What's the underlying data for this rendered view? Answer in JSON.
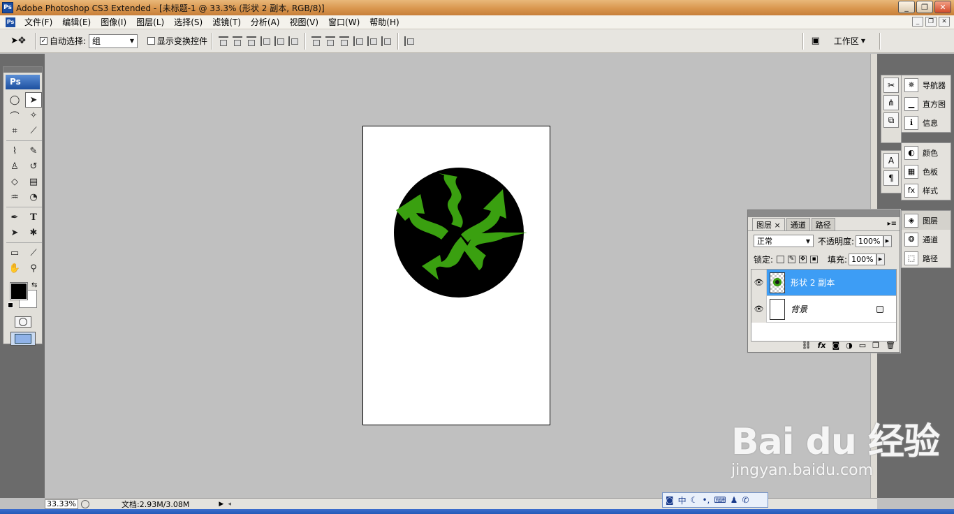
{
  "window": {
    "title": "Adobe Photoshop CS3 Extended - [未标题-1 @ 33.3% (形状 2 副本, RGB/8)]",
    "app_badge": "Ps",
    "buttons": [
      "_",
      "❐",
      "✕"
    ]
  },
  "menu": {
    "items": [
      "文件(F)",
      "编辑(E)",
      "图像(I)",
      "图层(L)",
      "选择(S)",
      "滤镜(T)",
      "分析(A)",
      "视图(V)",
      "窗口(W)",
      "帮助(H)"
    ],
    "doc_buttons": [
      "_",
      "❐",
      "✕"
    ]
  },
  "options": {
    "auto_select_label": "自动选择:",
    "auto_select_checked": "✓",
    "auto_select_value": "组",
    "show_transform_label": "显示变换控件",
    "workspace_label": "工作区"
  },
  "toolbox": {
    "logo": "Ps"
  },
  "dock": {
    "group1": [
      "导航器",
      "直方图",
      "信息"
    ],
    "group2": [
      "颜色",
      "色板",
      "样式"
    ],
    "group3": [
      "图层",
      "通道",
      "路径"
    ]
  },
  "layers_panel": {
    "tabs": [
      "图层 ×",
      "通道",
      "路径"
    ],
    "blend_mode": "正常",
    "opacity_label": "不透明度:",
    "opacity_value": "100%",
    "lock_label": "锁定:",
    "fill_label": "填充:",
    "fill_value": "100%",
    "layers": [
      {
        "name": "形状 2 副本",
        "selected": true
      },
      {
        "name": "背景",
        "selected": false
      }
    ]
  },
  "status": {
    "zoom": "33.33%",
    "doc_info": "文档:2.93M/3.08M"
  },
  "ime": {
    "items": [
      "中"
    ]
  },
  "watermark": {
    "logo": "Bai du 经验",
    "url": "jingyan.baidu.com"
  },
  "colors": {
    "shape_green": "#3aa010",
    "circle_black": "#000000",
    "layer_selected": "#3d9df5"
  }
}
